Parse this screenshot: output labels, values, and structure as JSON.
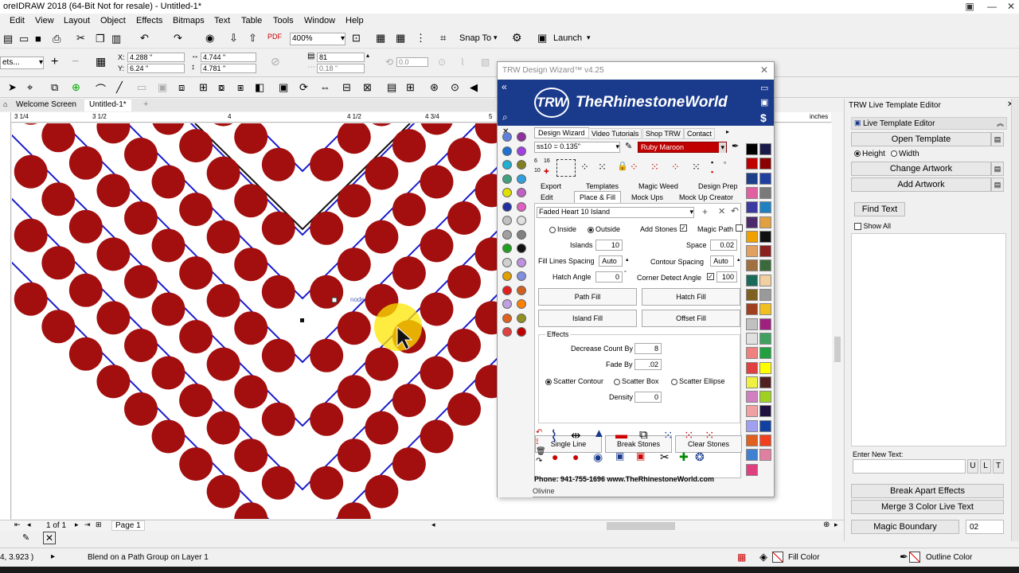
{
  "window": {
    "title": "oreIDRAW 2018 (64-Bit Not for resale) - Untitled-1*"
  },
  "menu": [
    "Edit",
    "View",
    "Layout",
    "Object",
    "Effects",
    "Bitmaps",
    "Text",
    "Table",
    "Tools",
    "Window",
    "Help"
  ],
  "toolbar": {
    "zoom": "400%",
    "snap_to": "Snap To",
    "launch": "Launch"
  },
  "propbar": {
    "x": "4.288 \"",
    "y": "6.24 \"",
    "w": "4.744 \"",
    "h": "4.781 \"",
    "steps": "81",
    "spacing": "0.18 \"",
    "angle": "0.0",
    "preset_label": "ets...",
    "x_label": "X:",
    "y_label": "Y:"
  },
  "doc_tabs": {
    "welcome": "Welcome Screen",
    "untitled": "Untitled-1*"
  },
  "ruler": {
    "unit": "inches",
    "labels": [
      "3 1/4",
      "3 1/2",
      "4",
      "4 1/2",
      "4 3/4",
      "5"
    ]
  },
  "canvas": {
    "node_label": "node"
  },
  "page_nav": {
    "count": "1 of 1",
    "page": "Page 1"
  },
  "status": {
    "coords": "4, 3.923 )",
    "message": "Blend on a Path Group on Layer 1",
    "fill": "Fill Color",
    "outline": "Outline Color"
  },
  "trw": {
    "title": "TRW Design Wizard™ v4.25",
    "brand": "TheRhinestoneWorld",
    "logo": "TRW",
    "tabs_top": [
      "Design Wizard",
      "Video Tutorials",
      "Shop TRW",
      "Contact"
    ],
    "stone_size": "ss10 = 0.135\"",
    "stone_color": "Ruby Maroon",
    "tabs_row1": [
      "Export",
      "Templates",
      "Magic Weed",
      "Design Prep"
    ],
    "tabs_row2": [
      "Edit",
      "Place & Fill",
      "Mock Ups",
      "Mock Up Creator"
    ],
    "template_name": "Faded Heart 10 Island",
    "inside": "Inside",
    "outside": "Outside",
    "add_stones": "Add Stones",
    "magic_path": "Magic Path",
    "islands_label": "Islands",
    "islands": "10",
    "space_label": "Space",
    "space": "0.02",
    "fill_lines_label": "Fill Lines Spacing",
    "fill_lines": "Auto",
    "contour_label": "Contour Spacing",
    "contour": "Auto",
    "hatch_angle_label": "Hatch Angle",
    "hatch_angle": "0",
    "corner_label": "Corner Detect Angle",
    "corner": "100",
    "path_fill": "Path Fill",
    "hatch_fill": "Hatch Fill",
    "island_fill": "Island Fill",
    "offset_fill": "Offset Fill",
    "effects": "Effects",
    "decrease_label": "Decrease Count By",
    "decrease": "8",
    "fade_label": "Fade By",
    "fade": ".02",
    "scatter_contour": "Scatter Contour",
    "scatter_box": "Scatter Box",
    "scatter_ellipse": "Scatter Ellipse",
    "density_label": "Density",
    "density": "0",
    "single_line": "Single Line",
    "break_stones": "Break Stones",
    "clear_stones": "Clear Stones",
    "footer_phone": "Phone: 941-755-1696  www.TheRhinestoneWorld.com",
    "footer_color": "Olivine",
    "right_swatches": [
      "#000000",
      "#1a1a4a",
      "#c00000",
      "#8b0000",
      "#1e3f8a",
      "#2040a0",
      "#e060a0",
      "#7a7a7a",
      "#3a3aa0",
      "#2080c0",
      "#4a2a6a",
      "#e0a040",
      "#f0a000",
      "#101010",
      "#e0a060",
      "#8b2020",
      "#a07040",
      "#3a6a3a",
      "#1a6a5a",
      "#f0d0a0",
      "#806020",
      "#9a9a9a",
      "#a04020",
      "#f0c020",
      "#c0c0c0",
      "#a02080",
      "#e0e0e0",
      "#40a060",
      "#f08080",
      "#20a040",
      "#e04040",
      "#ffff00",
      "#f0f040",
      "#502020",
      "#d080c0",
      "#a0d020",
      "#f0a0a0",
      "#201040",
      "#a0a0f0",
      "#1040a0",
      "#e06020",
      "#f04020",
      "#4080d0",
      "#e080a0",
      "#e04080"
    ],
    "left_dots": [
      "#6080e0",
      "#9030a0",
      "#2070d0",
      "#a040e0",
      "#20b0d0",
      "#808020",
      "#40a080",
      "#30a0e0",
      "#e0e000",
      "#c060c0",
      "#2030a0",
      "#e060c0",
      "#c0c0c0",
      "#e0e0e0",
      "#a0a0a0",
      "#808080",
      "#20a020",
      "#101010",
      "#d0d0d0",
      "#c090e0",
      "#e0a000",
      "#8090e0",
      "#e02020",
      "#d06020",
      "#c0a0e0",
      "#ff8000",
      "#e06020",
      "#909020",
      "#e04040",
      "#c00000"
    ]
  },
  "lte": {
    "title": "TRW Live Template Editor",
    "header": "Live Template Editor",
    "open_template": "Open Template",
    "height": "Height",
    "width": "Width",
    "change_artwork": "Change Artwork",
    "add_artwork": "Add Artwork",
    "find_text": "Find Text",
    "show_all": "Show All",
    "enter_new_text": "Enter New Text:",
    "u": "U",
    "l": "L",
    "t": "T",
    "break_apart": "Break Apart Effects",
    "merge": "Merge 3 Color Live Text",
    "magic_boundary": "Magic Boundary",
    "boundary_value": "02"
  },
  "colors": {
    "stone": "#a30f0f",
    "path": "#1a1acc",
    "banner": "#1a3a8c"
  }
}
